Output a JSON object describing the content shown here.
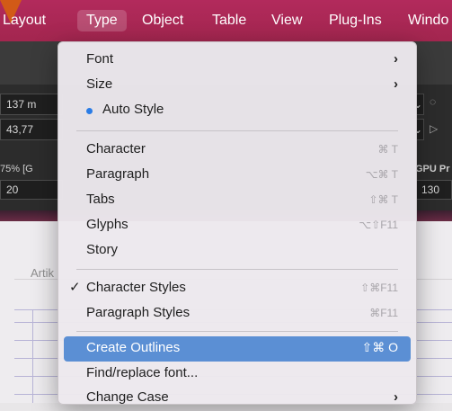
{
  "menubar": {
    "items": [
      "Layout",
      "Type",
      "Object",
      "Table",
      "View",
      "Plug-Ins",
      "Windo"
    ],
    "active": "Type"
  },
  "chrome": {
    "field1": "137 m",
    "field2": "43,77",
    "zoom_label": "75% [G",
    "field3": "20",
    "gpu_label": "GPU Pr",
    "field4": "130"
  },
  "document": {
    "text": "Artik"
  },
  "menu": {
    "items": [
      {
        "label": "Font",
        "submenu": true
      },
      {
        "label": "Size",
        "submenu": true
      },
      {
        "label": "Auto Style",
        "dot": true
      },
      {
        "label": "Character",
        "shortcut": "⌘ T"
      },
      {
        "label": "Paragraph",
        "shortcut": "⌥⌘ T"
      },
      {
        "label": "Tabs",
        "shortcut": "⇧⌘ T"
      },
      {
        "label": "Glyphs",
        "shortcut": "⌥⇧F11"
      },
      {
        "label": "Story"
      },
      {
        "label": "Character Styles",
        "shortcut": "⇧⌘F11",
        "checked": true
      },
      {
        "label": "Paragraph Styles",
        "shortcut": "⌘F11"
      },
      {
        "label": "Create Outlines",
        "shortcut": "⇧⌘ O",
        "highlighted": true
      },
      {
        "label": "Find/replace font..."
      },
      {
        "label": "Change Case",
        "submenu": true
      }
    ]
  },
  "icons": {
    "chevron": "›",
    "check": "✓",
    "dropdown": "⌄"
  },
  "colors": {
    "menubar": "#a3264f",
    "highlight": "#5b8fd4",
    "dot": "#2a7ce6",
    "corner_arrow": "#d25a17"
  }
}
